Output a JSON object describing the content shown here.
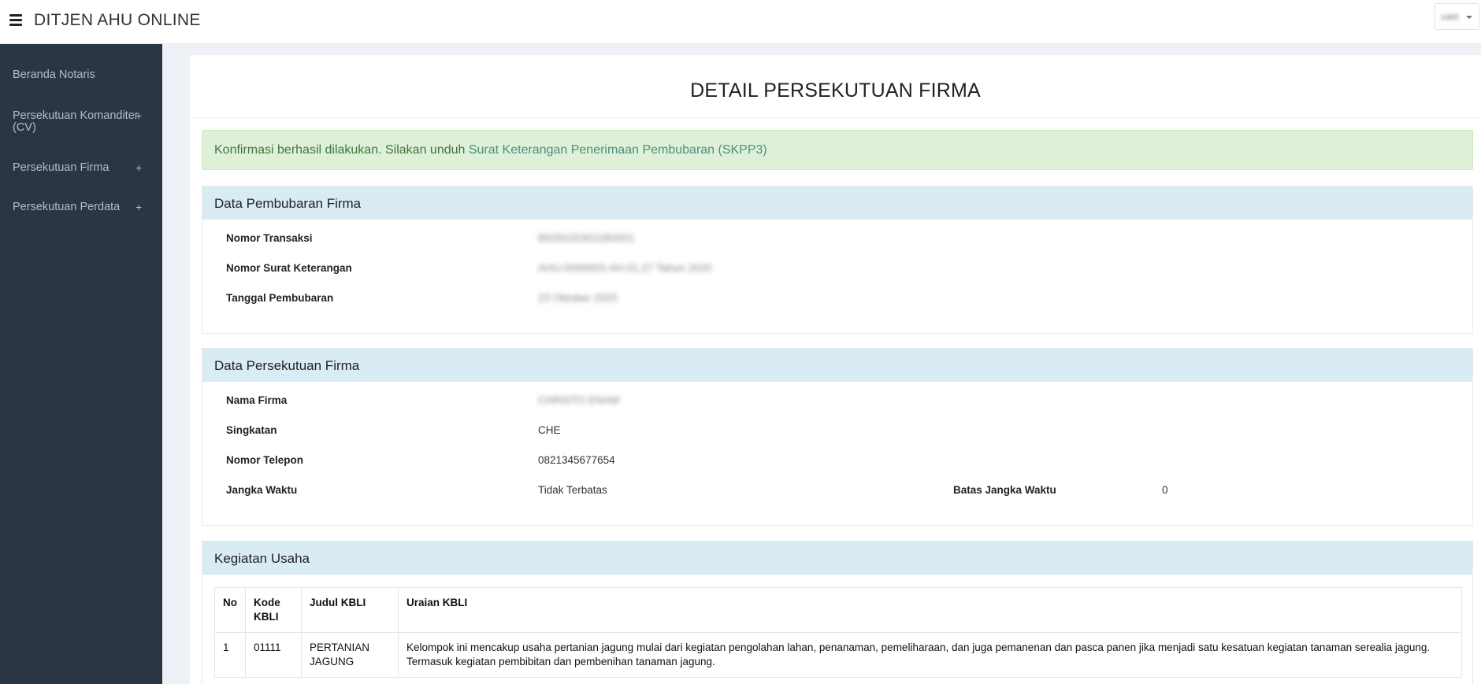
{
  "header": {
    "app_title": "DITJEN AHU ONLINE",
    "menu_icon": "hamburger-icon",
    "user_name": "sakti",
    "dropdown_icon": "caret-down-icon"
  },
  "sidebar": {
    "items": [
      {
        "label": "Beranda Notaris",
        "expand": ""
      },
      {
        "label": "Persekutuan Komanditer (CV)",
        "expand": "+"
      },
      {
        "label": "Persekutuan Firma",
        "expand": "+"
      },
      {
        "label": "Persekutuan Perdata",
        "expand": "+"
      }
    ]
  },
  "main": {
    "page_title": "DETAIL PERSEKUTUAN FIRMA",
    "alert": {
      "text": "Konfirmasi berhasil dilakukan. Silakan unduh ",
      "link": "Surat Keterangan Penerimaan Pembubaran (SKPP3)",
      "color": "#dff0d8"
    },
    "pembubaran": {
      "title": "Data Pembubaran Firma",
      "fields": [
        {
          "label": "Nomor Transaksi",
          "value": "B0291023011B0001"
        },
        {
          "label": "Nomor Surat Keterangan",
          "value": "AHU-0000003-AH.01.27 Tahun 2020"
        },
        {
          "label": "Tanggal Pembubaran",
          "value": "23 Oktober 2020"
        }
      ]
    },
    "firma": {
      "title": "Data Persekutuan Firma",
      "fields": [
        {
          "label": "Nama Firma",
          "value": "CHRISTO ENAM"
        },
        {
          "label": "Singkatan",
          "value": "CHE"
        },
        {
          "label": "Nomor Telepon",
          "value": "0821345677654"
        },
        {
          "label": "Jangka Waktu",
          "value": "Tidak Terbatas"
        }
      ],
      "batas_label": "Batas Jangka Waktu",
      "batas_value": "0"
    },
    "kegiatan": {
      "title": "Kegiatan Usaha",
      "columns": [
        "No",
        "Kode KBLI",
        "Judul KBLI",
        "Uraian KBLI"
      ],
      "rows": [
        {
          "no": "1",
          "kode": "01111",
          "judul": "PERTANIAN JAGUNG",
          "uraian": "Kelompok ini mencakup usaha pertanian jagung mulai dari kegiatan pengolahan lahan, penanaman, pemeliharaan, dan juga pemanenan dan pasca panen jika menjadi satu kesatuan kegiatan tanaman serealia jagung. Termasuk kegiatan pembibitan dan pembenihan tanaman jagung."
        }
      ]
    }
  }
}
